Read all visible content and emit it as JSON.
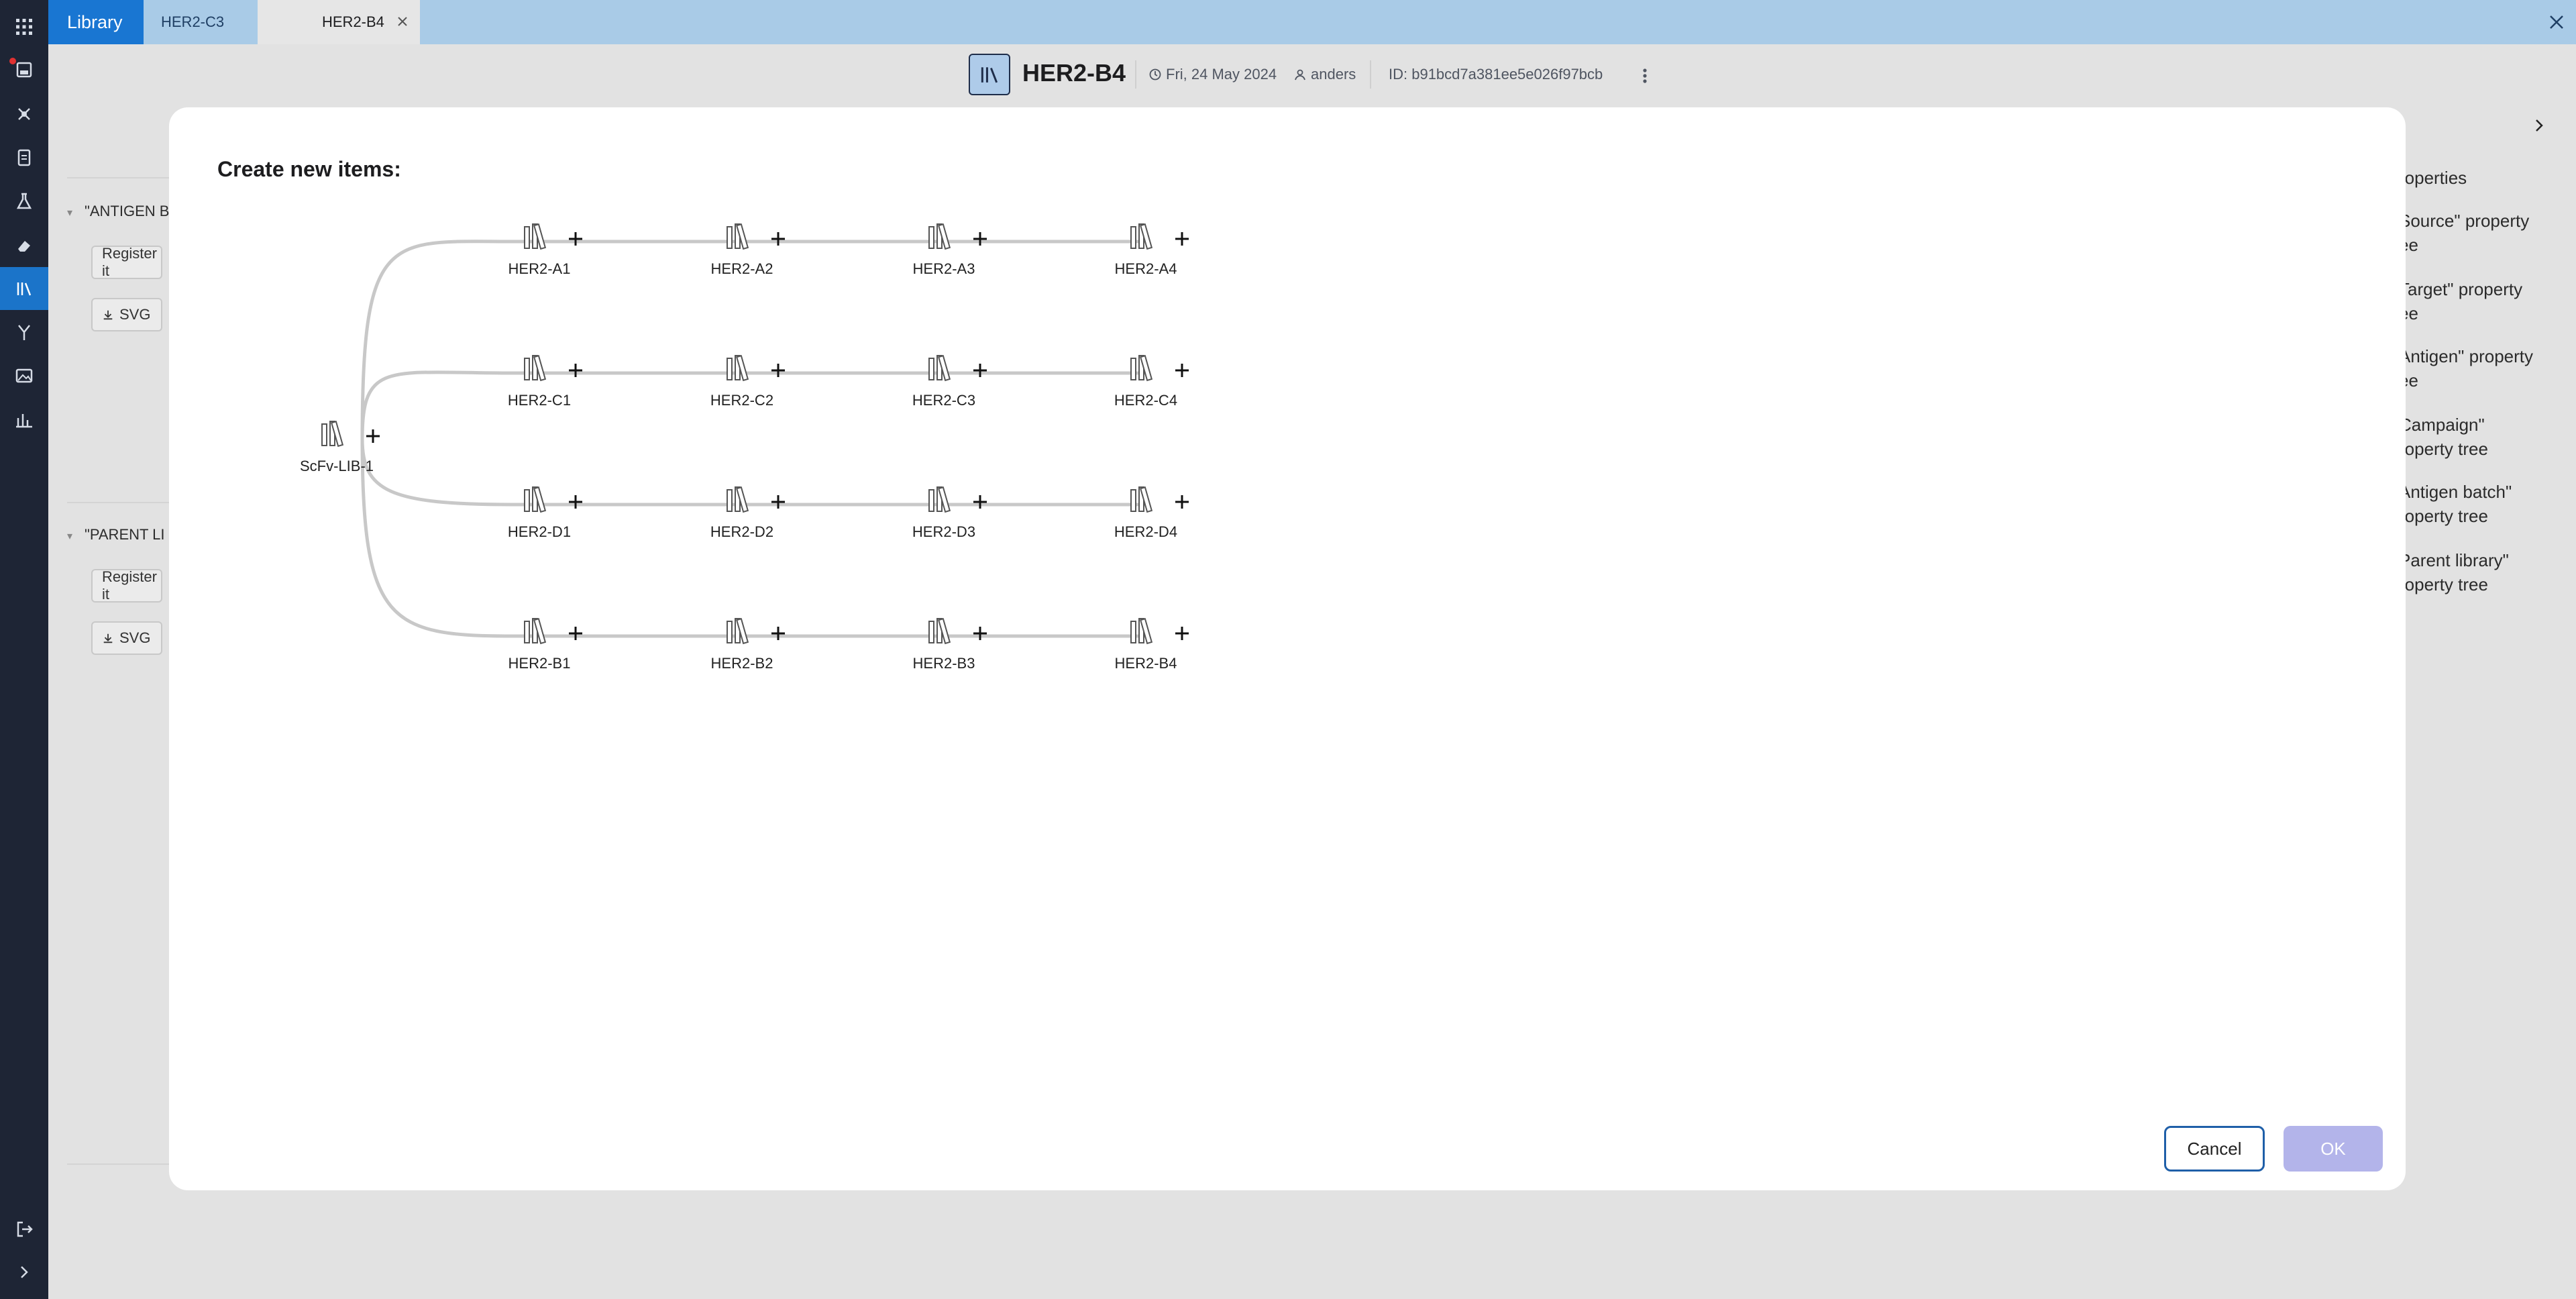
{
  "tabs": {
    "library": "Library",
    "tab2": "HER2-C3",
    "tab3": "HER2-B4"
  },
  "header": {
    "title": "HER2-B4",
    "date": "Fri, 24 May 2024",
    "user": "anders",
    "id": "ID: b91bcd7a381ee5e026f97bcb"
  },
  "background": {
    "section1": "\"ANTIGEN B",
    "section2": "\"PARENT LI",
    "register_label": "Register it",
    "svg_label": "SVG",
    "right_panel": [
      "roperties",
      "Source\" property",
      "ee",
      "Target\" property",
      "ee",
      "Antigen\" property",
      "ee",
      "Campaign\"",
      "roperty tree",
      "Antigen batch\"",
      "roperty tree",
      "Parent library\"",
      "roperty tree"
    ]
  },
  "modal": {
    "title": "Create new items:",
    "root": "ScFv-LIB-1",
    "rows": [
      [
        "HER2-A1",
        "HER2-A2",
        "HER2-A3",
        "HER2-A4"
      ],
      [
        "HER2-C1",
        "HER2-C2",
        "HER2-C3",
        "HER2-C4"
      ],
      [
        "HER2-D1",
        "HER2-D2",
        "HER2-D3",
        "HER2-D4"
      ],
      [
        "HER2-B1",
        "HER2-B2",
        "HER2-B3",
        "HER2-B4"
      ]
    ],
    "cancel": "Cancel",
    "ok": "OK"
  },
  "colors": {
    "rail": "#1e2535",
    "accent": "#1976d2",
    "tabbar": "#a9cbe7",
    "ok_disabled": "#b3b4ea"
  }
}
